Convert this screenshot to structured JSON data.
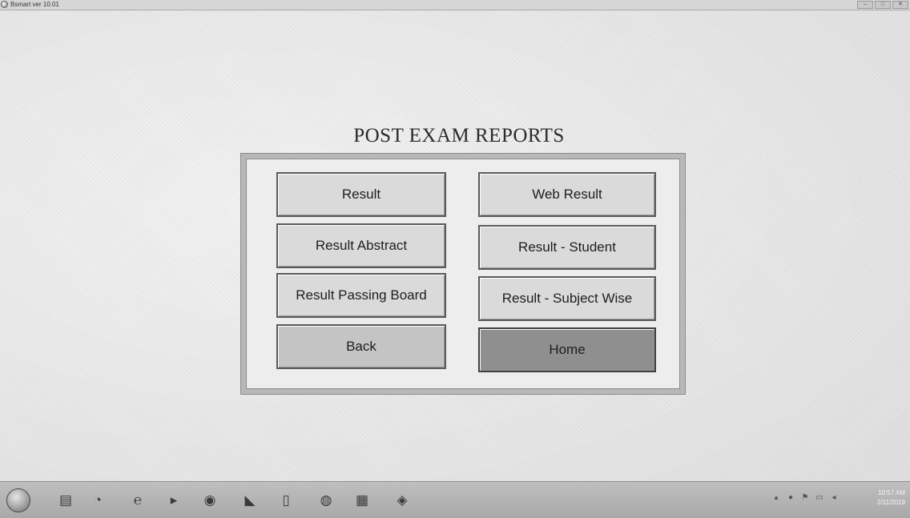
{
  "window": {
    "title": "Bsmart ver 10.01",
    "minimize_glyph": "–",
    "maximize_glyph": "□",
    "close_glyph": "✕"
  },
  "page": {
    "heading": "POST EXAM REPORTS"
  },
  "buttons": {
    "result": "Result",
    "web_result": "Web Result",
    "result_abstract": "Result Abstract",
    "result_student": "Result - Student",
    "result_passing_board": "Result Passing Board",
    "result_subject_wise": "Result - Subject Wise",
    "back": "Back",
    "home": "Home"
  },
  "taskbar": {
    "icons": [
      "start-orb",
      "explorer-icon",
      "chrome-icon",
      "ie-icon",
      "media-player-icon",
      "firefox-icon",
      "acrobat-icon",
      "document-icon",
      "network-icon",
      "notepad-icon",
      "app-icon"
    ],
    "clock_time": "10:57 AM",
    "clock_date": "2/11/2019"
  }
}
